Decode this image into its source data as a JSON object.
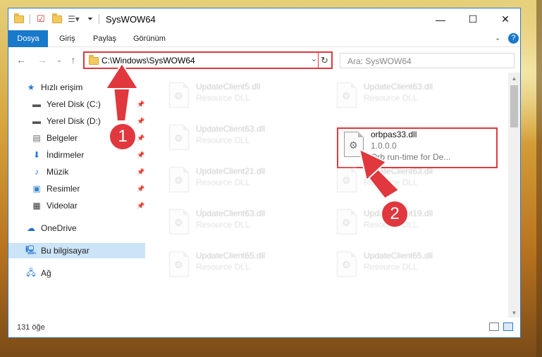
{
  "window": {
    "title": "SysWOW64",
    "controls": {
      "minimize": "—",
      "maximize": "☐",
      "close": "✕"
    }
  },
  "ribbon": {
    "tabs": [
      "Dosya",
      "Giriş",
      "Paylaş",
      "Görünüm"
    ]
  },
  "address": {
    "path": "C:\\Windows\\SysWOW64",
    "search_placeholder": "Ara: SysWOW64"
  },
  "nav": {
    "items": [
      {
        "label": "Hızlı erişim",
        "icon": "star-icon",
        "pinned": false
      },
      {
        "label": "Yerel Disk (C:)",
        "icon": "drive-icon",
        "pinned": true
      },
      {
        "label": "Yerel Disk (D:)",
        "icon": "drive-icon",
        "pinned": true
      },
      {
        "label": "Belgeler",
        "icon": "documents-icon",
        "pinned": true
      },
      {
        "label": "İndirmeler",
        "icon": "download-icon",
        "pinned": true
      },
      {
        "label": "Müzik",
        "icon": "music-icon",
        "pinned": true
      },
      {
        "label": "Resimler",
        "icon": "pictures-icon",
        "pinned": true
      },
      {
        "label": "Videolar",
        "icon": "videos-icon",
        "pinned": true
      },
      {
        "label": "OneDrive",
        "icon": "cloud-icon",
        "pinned": false
      },
      {
        "label": "Bu bilgisayar",
        "icon": "computer-icon",
        "pinned": false,
        "selected": true
      },
      {
        "label": "Ağ",
        "icon": "network-icon",
        "pinned": false
      }
    ]
  },
  "files": {
    "left": [
      {
        "name": "UpdateClient5.dll",
        "desc": "Resource DLL"
      },
      {
        "name": "UpdateClient63.dll",
        "desc": "Resource DLL"
      },
      {
        "name": "UpdateClient21.dll",
        "desc": "Resource DLL"
      },
      {
        "name": "UpdateClient63.dll",
        "desc": "Resource DLL"
      },
      {
        "name": "UpdateClient65.dll",
        "desc": "Resource DLL"
      }
    ],
    "right": [
      {
        "name": "UpdateClient63.dll",
        "desc": "Resource DLL"
      },
      {
        "name": "orbpas33.dll",
        "version": "1.0.0.0",
        "desc": "Orb run-time for De..."
      },
      {
        "name": "UpdateClient63.dll",
        "desc": "Resource DLL"
      },
      {
        "name": "UpdateClient19.dll",
        "desc": "Resource DLL"
      },
      {
        "name": "UpdateClient65.dll",
        "desc": "Resource DLL"
      }
    ]
  },
  "status": {
    "item_count": "131 öğe"
  },
  "annotations": {
    "badge1": "1",
    "badge2": "2",
    "color": "#e0383e"
  }
}
